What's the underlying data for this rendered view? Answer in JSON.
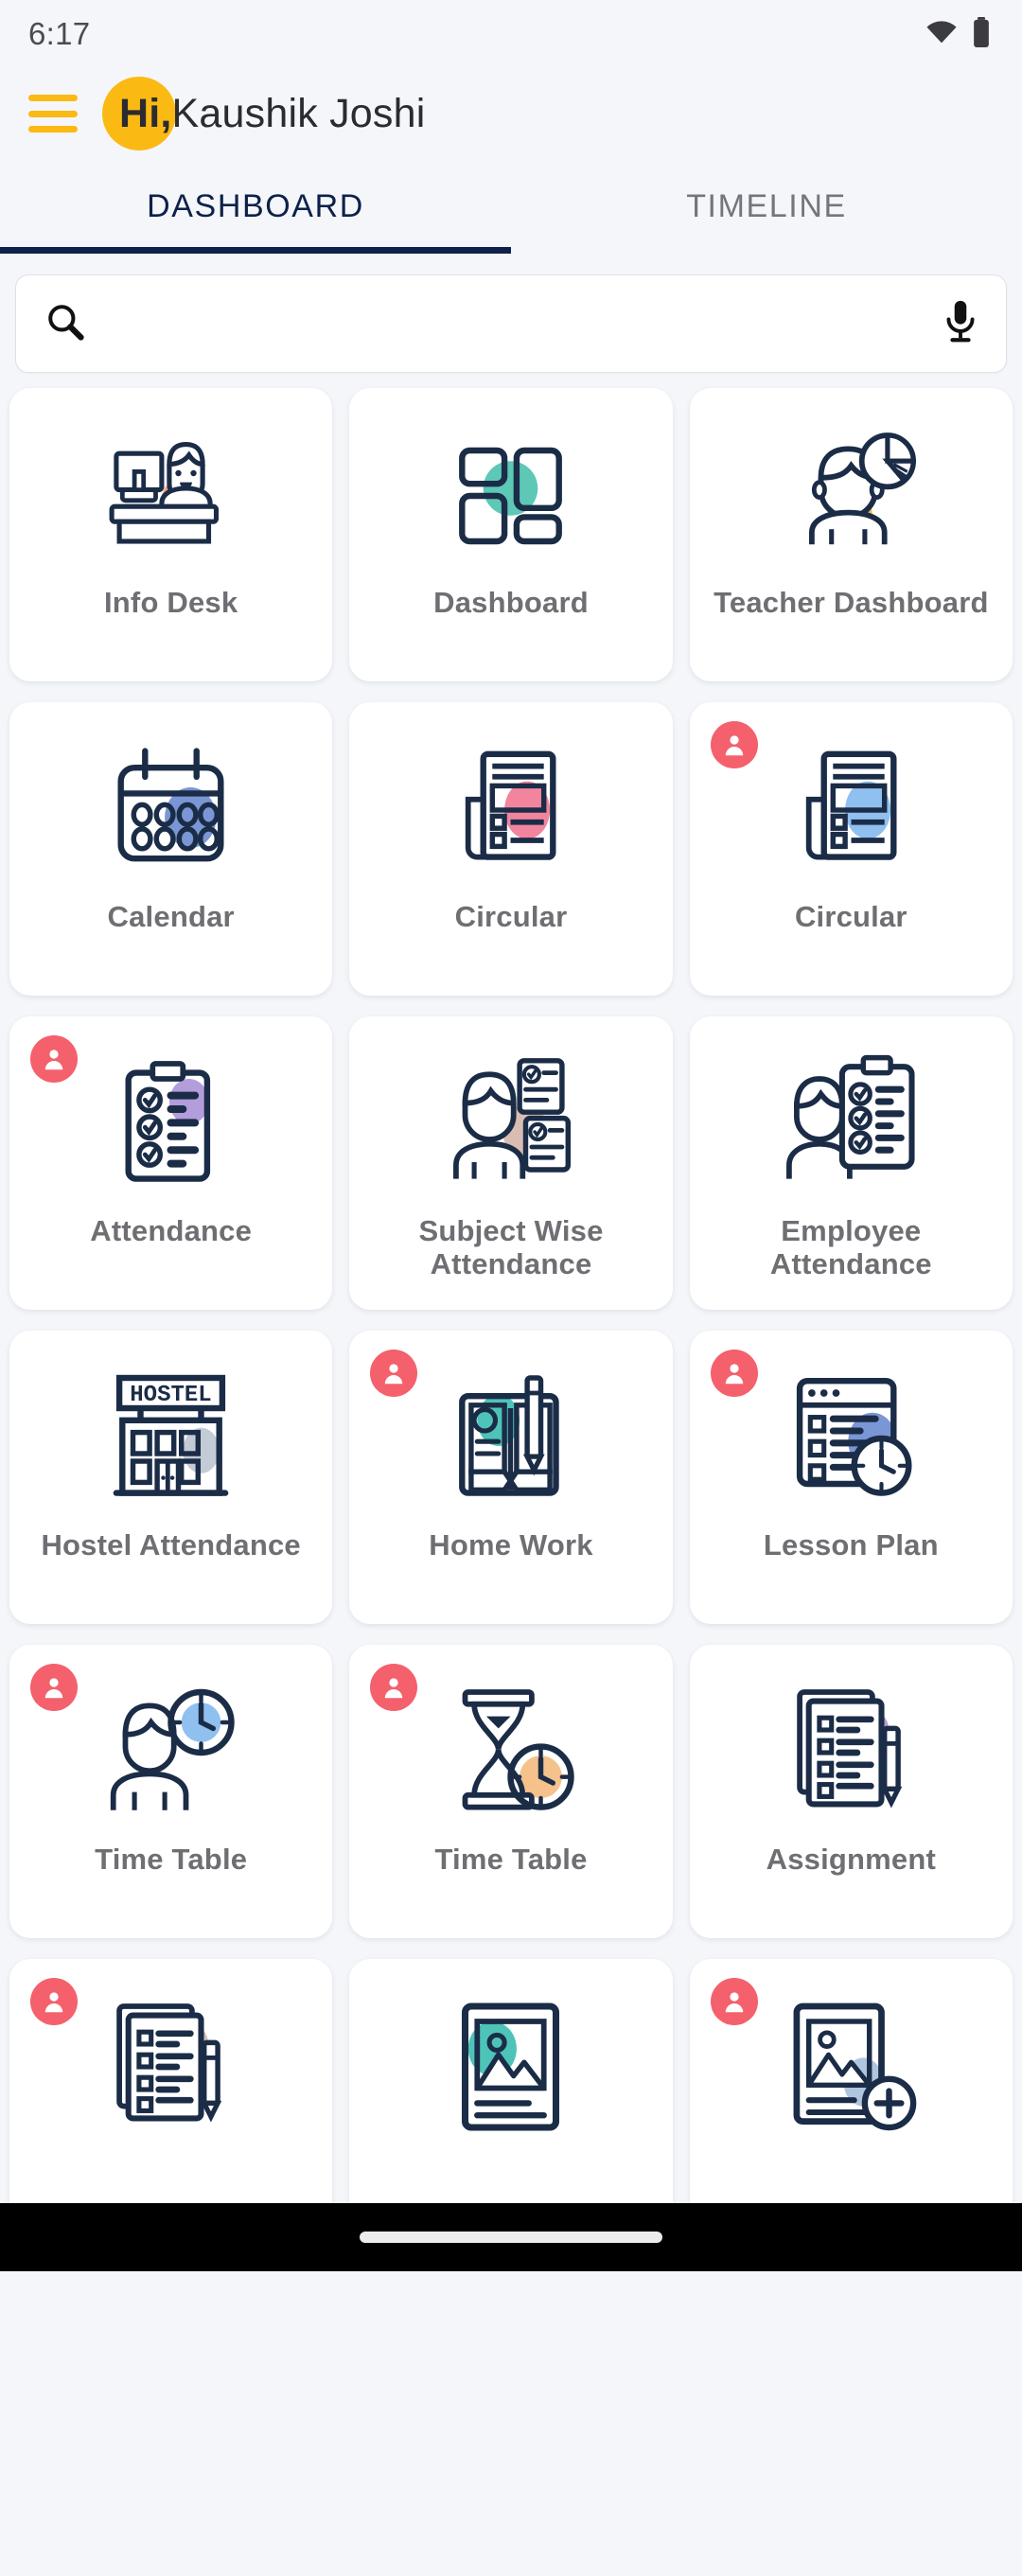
{
  "status_bar": {
    "time": "6:17",
    "wifi_icon": "wifi-icon",
    "battery_icon": "battery-icon"
  },
  "app_bar": {
    "menu_icon": "hamburger-menu-icon",
    "avatar_color": "#FBB913",
    "greeting": "Hi,",
    "user_name": "Kaushik  Joshi"
  },
  "tabs": {
    "active_index": 0,
    "items": [
      {
        "label": "DASHBOARD",
        "active": true
      },
      {
        "label": "TIMELINE",
        "active": false
      }
    ],
    "active_color": "#0D2149",
    "inactive_color": "#73767D"
  },
  "search": {
    "placeholder": "",
    "value": "",
    "search_icon": "search-icon",
    "mic_icon": "microphone-icon"
  },
  "grid": {
    "badge_color": "#F4606C",
    "tiles": [
      {
        "label": "Info Desk",
        "art": "info-desk",
        "accent": "#F4A58A",
        "badge": false
      },
      {
        "label": "Dashboard",
        "art": "dashboard-grid",
        "accent": "#5EC8B7",
        "badge": false
      },
      {
        "label": "Teacher Dashboard",
        "art": "teacher-chart",
        "accent": "#F2C14E",
        "badge": false
      },
      {
        "label": "Calendar",
        "art": "calendar",
        "accent": "#7B96D4",
        "badge": false
      },
      {
        "label": "Circular",
        "art": "newspaper",
        "accent": "#F2849E",
        "badge": false
      },
      {
        "label": "Circular",
        "art": "newspaper",
        "accent": "#8FC0F0",
        "badge": true
      },
      {
        "label": "Attendance",
        "art": "checklist",
        "accent": "#B39DDB",
        "badge": true
      },
      {
        "label": "Subject Wise Attendance",
        "art": "person-docs",
        "accent": "#D9BDB2",
        "badge": false
      },
      {
        "label": "Employee Attendance",
        "art": "person-clipboard",
        "accent": "#4EE0B8",
        "badge": false
      },
      {
        "label": "Hostel Attendance",
        "art": "hostel-building",
        "accent": "#C3CBD6",
        "badge": false
      },
      {
        "label": "Home Work",
        "art": "book-pencil",
        "accent": "#4EC3B8",
        "badge": true
      },
      {
        "label": "Lesson Plan",
        "art": "document-clock",
        "accent": "#7B96D4",
        "badge": true
      },
      {
        "label": "Time Table",
        "art": "person-clock",
        "accent": "#8FC0F0",
        "badge": true
      },
      {
        "label": "Time Table",
        "art": "hourglass-clock",
        "accent": "#F5C28B",
        "badge": true
      },
      {
        "label": "Assignment",
        "art": "documents-pen",
        "accent": "#B39DDB",
        "badge": false
      },
      {
        "label": "",
        "art": "documents-pen",
        "accent": "#D9BDB2",
        "badge": true
      },
      {
        "label": "",
        "art": "gallery",
        "accent": "#4EC3B8",
        "badge": false
      },
      {
        "label": "",
        "art": "gallery-add",
        "accent": "#AFC6DC",
        "badge": true
      }
    ]
  },
  "bottom_nav": {
    "gesture_pill": "home-gesture-pill"
  }
}
